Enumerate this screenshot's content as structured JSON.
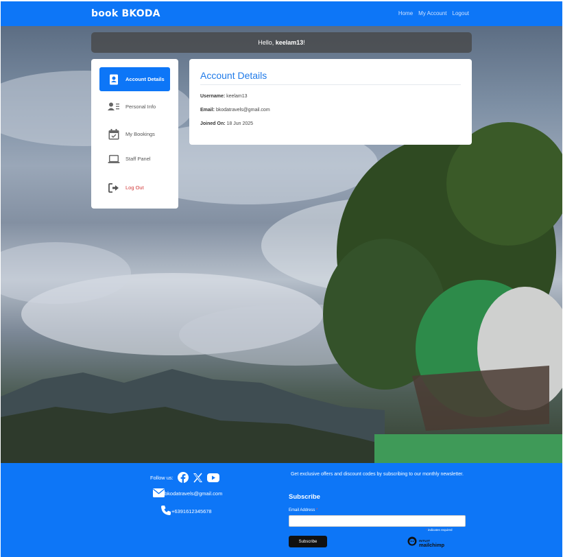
{
  "navbar": {
    "brand": "book BKODA",
    "links": [
      "Home",
      "My Account",
      "Logout"
    ]
  },
  "hello": {
    "prefix": "Hello, ",
    "username": "keelam13",
    "suffix": "!"
  },
  "sidebar": {
    "items": [
      {
        "label": "Account Details",
        "icon": "id-card-icon",
        "active": true
      },
      {
        "label": "Personal Info",
        "icon": "user-list-icon"
      },
      {
        "label": "My Bookings",
        "icon": "calendar-check-icon"
      },
      {
        "label": "Staff Panel",
        "icon": "laptop-icon"
      },
      {
        "label": "Log Out",
        "icon": "sign-out-icon"
      }
    ]
  },
  "account": {
    "title": "Account Details",
    "username_label": "Username:",
    "username": "keelam13",
    "email_label": "Email:",
    "email": "bkodatravels@gmail.com",
    "joined_label": "Joined On:",
    "joined": "18 Jun 2025"
  },
  "footer": {
    "follow_label": "Follow us:",
    "social_icons": [
      "facebook-icon",
      "x-twitter-icon",
      "youtube-icon"
    ],
    "email": "bkodatravels@gmail.com",
    "phone": "+6391612345678",
    "offer_text": "Get exclusive offers and discount codes by subscribing to our monthly newsletter.",
    "subscribe_title": "Subscribe",
    "email_field_label": "Email Address",
    "required_marker": "*",
    "required_note": "indicates required",
    "subscribe_button": "Subscribe",
    "mailchimp_line1": "INTUIT",
    "mailchimp_line2": "mailchimp"
  },
  "colors": {
    "primary": "#0d76f7",
    "title_blue": "#1f7ae8",
    "logout_red": "#d23a3a"
  }
}
